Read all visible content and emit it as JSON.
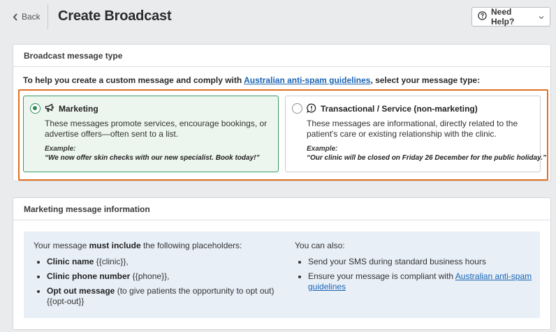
{
  "header": {
    "back_label": "Back",
    "title": "Create Broadcast",
    "help_label": "Need Help?"
  },
  "type_card": {
    "heading": "Broadcast message type",
    "intro_before": "To help you create a custom message and comply with ",
    "intro_link": "Australian anti-spam guidelines",
    "intro_after": ", select your message type:",
    "options": [
      {
        "title": "Marketing",
        "selected": true,
        "icon": "megaphone-icon",
        "description": "These messages promote services, encourage bookings, or advertise offers—often sent to a list.",
        "example_label": "Example:",
        "example": "“We now offer skin checks with our new specialist. Book today!”"
      },
      {
        "title": "Transactional / Service (non-marketing)",
        "selected": false,
        "icon": "message-alert-icon",
        "description": "These messages are informational, directly related to the patient's care or existing relationship with the clinic.",
        "example_label": "Example:",
        "example": "“Our clinic will be closed on Friday 26 December for the public holiday.”"
      }
    ]
  },
  "info_card": {
    "heading": "Marketing message information",
    "left": {
      "head_before": "Your message ",
      "head_bold": "must include",
      "head_after": " the following placeholders:",
      "items": [
        {
          "bold": "Clinic name",
          "rest": " {{clinic}},"
        },
        {
          "bold": "Clinic phone number",
          "rest": " {{phone}},"
        },
        {
          "bold": "Opt out message",
          "rest": " (to give patients the opportunity to opt out) {{opt-out}}"
        }
      ]
    },
    "right": {
      "head": "You can also:",
      "item1": "Send your SMS during standard business hours",
      "item2_before": "Ensure your message is compliant with ",
      "item2_link": "Australian anti-spam guidelines"
    }
  },
  "colors": {
    "accent_green": "#2e8b57",
    "selected_bg": "#ecf6ef",
    "highlight_orange": "#e07020",
    "link_blue": "#1a64b5",
    "info_bg": "#e8eff7"
  }
}
